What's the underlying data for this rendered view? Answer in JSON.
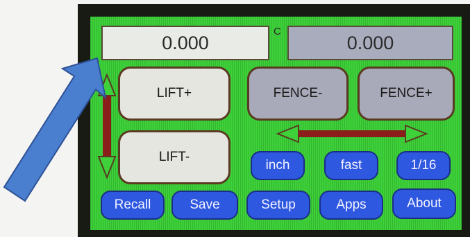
{
  "readouts": {
    "left_value": "0.000",
    "right_value": "0.000",
    "unit_label": "C"
  },
  "buttons": {
    "lift_up": "LIFT+",
    "lift_down": "LIFT-",
    "fence_minus": "FENCE-",
    "fence_plus": "FENCE+"
  },
  "toggles": {
    "units": "inch",
    "speed": "fast",
    "increment": "1/16"
  },
  "menu": {
    "recall": "Recall",
    "save": "Save",
    "setup": "Setup",
    "apps": "Apps",
    "about": "About"
  },
  "colors": {
    "screen_green": "#3ed13a",
    "button_blue": "#2f58e0",
    "arrow_brown": "#8b1e1a",
    "pointer_blue": "#4a7fd0"
  },
  "icons": {
    "vertical_arrow": "double-headed-vertical-arrow",
    "horizontal_arrow": "double-headed-horizontal-arrow",
    "pointer": "large-diagonal-arrow"
  }
}
